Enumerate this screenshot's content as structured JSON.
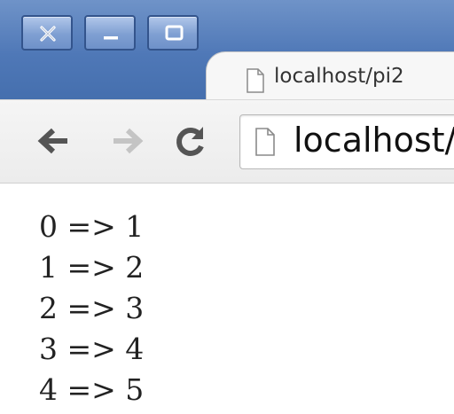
{
  "window": {
    "controls": [
      "close",
      "minimize",
      "maximize"
    ]
  },
  "tab": {
    "title": "localhost/pi2",
    "favicon_icon": "page-icon"
  },
  "toolbar": {
    "back_icon": "arrow-left-icon",
    "forward_icon": "arrow-right-icon",
    "reload_icon": "reload-icon",
    "url": "localhost/",
    "url_favicon_icon": "page-icon"
  },
  "content": {
    "lines": [
      "0 => 1",
      "1 => 2",
      "2 => 3",
      "3 => 4",
      "4 => 5"
    ]
  },
  "colors": {
    "titlebar": "#4f78b7",
    "window_button": "#7f9fd2",
    "toolbar": "#f0f0f0",
    "page_background": "#ffffff",
    "text": "#222222"
  }
}
